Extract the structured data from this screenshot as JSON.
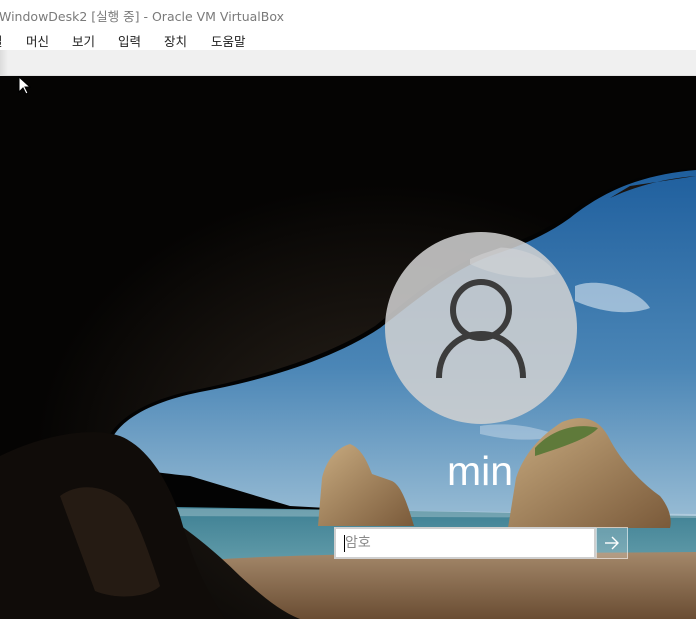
{
  "window": {
    "title": "WindowDesk2 [실행 중] - Oracle VM VirtualBox"
  },
  "menubar": {
    "items": [
      {
        "label": "일"
      },
      {
        "label": "머신"
      },
      {
        "label": "보기"
      },
      {
        "label": "입력"
      },
      {
        "label": "장치"
      },
      {
        "label": "도움말"
      }
    ]
  },
  "login": {
    "avatar_icon": "user-silhouette-icon",
    "username": "min",
    "password_placeholder": "암호",
    "submit_icon": "arrow-right-icon"
  },
  "colors": {
    "title_text": "#7a7a7a",
    "menu_text": "#202020",
    "toolbar_bg": "#f0f0f0",
    "avatar_bg": "#d2d2d2",
    "username_text": "#ffffff"
  }
}
